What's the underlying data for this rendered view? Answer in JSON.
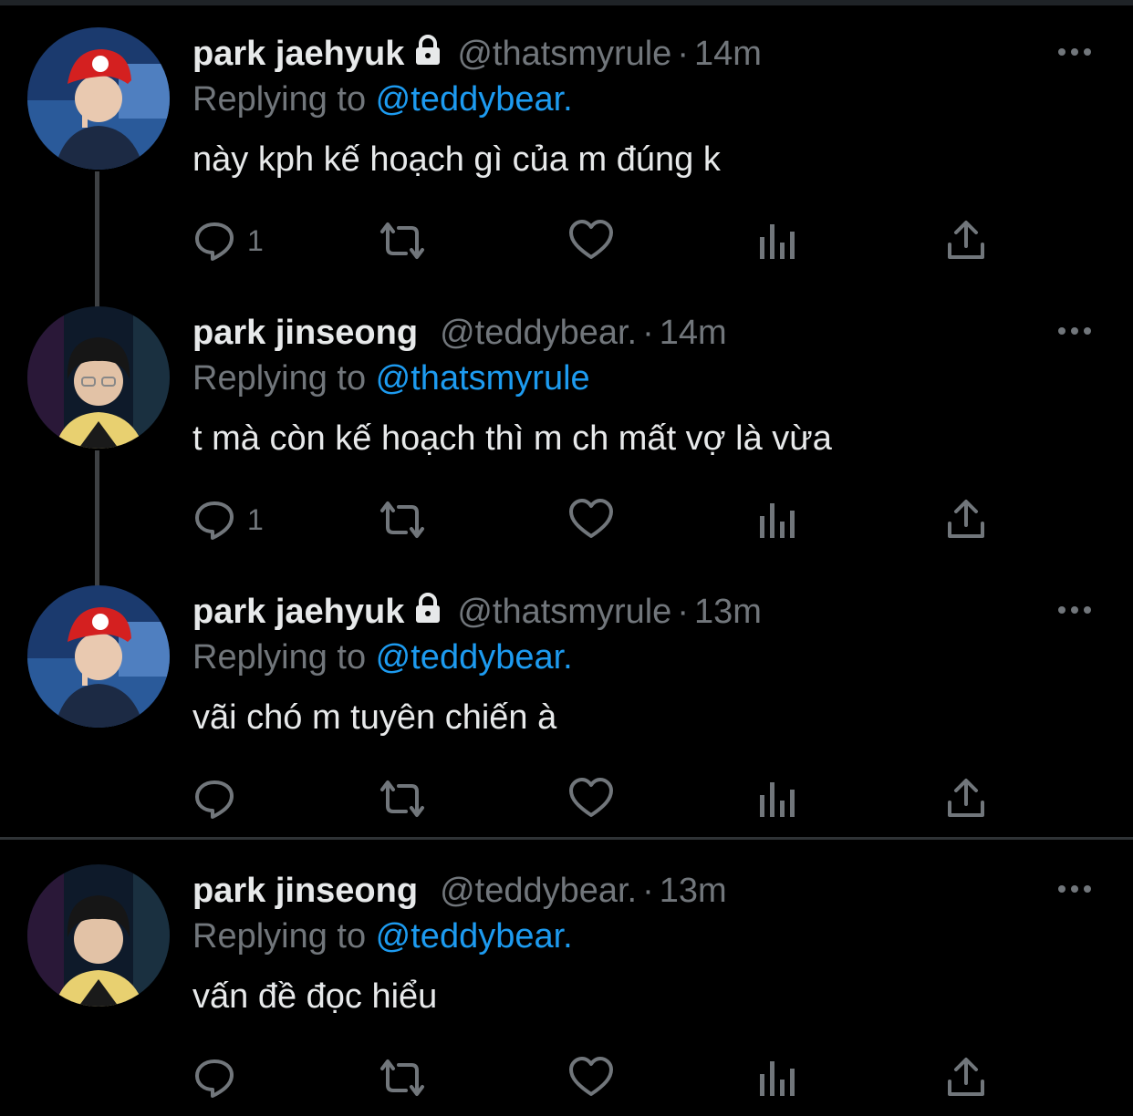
{
  "colors": {
    "background": "#000000",
    "text": "#e7e9ea",
    "secondary": "#71767b",
    "link": "#1d9bf0",
    "divider": "#2f3336"
  },
  "tweets": [
    {
      "display_name": "park jaehyuk",
      "locked": true,
      "handle": "@thatsmyrule",
      "dot": "·",
      "time": "14m",
      "replying_prefix": "Replying to ",
      "replying_to": "@teddybear.",
      "text": "này kph kế hoạch gì của m đúng k",
      "reply_count": "1",
      "avatar": "mario-cap-avatar"
    },
    {
      "display_name": "park jinseong",
      "locked": false,
      "handle": "@teddybear.",
      "dot": "·",
      "time": "14m",
      "replying_prefix": "Replying to ",
      "replying_to": "@thatsmyrule",
      "text": "t mà còn kế hoạch thì m ch mất vợ là vừa",
      "reply_count": "1",
      "avatar": "dark-hair-avatar"
    },
    {
      "display_name": "park jaehyuk",
      "locked": true,
      "handle": "@thatsmyrule",
      "dot": "·",
      "time": "13m",
      "replying_prefix": "Replying to ",
      "replying_to": "@teddybear.",
      "text": "vãi chó m tuyên chiến à",
      "reply_count": "",
      "avatar": "mario-cap-avatar"
    },
    {
      "display_name": "park jinseong",
      "locked": false,
      "handle": "@teddybear.",
      "dot": "·",
      "time": "13m",
      "replying_prefix": "Replying to ",
      "replying_to": "@teddybear.",
      "text": "vấn đề đọc hiểu",
      "reply_count": "",
      "avatar": "dark-hair-avatar"
    }
  ]
}
